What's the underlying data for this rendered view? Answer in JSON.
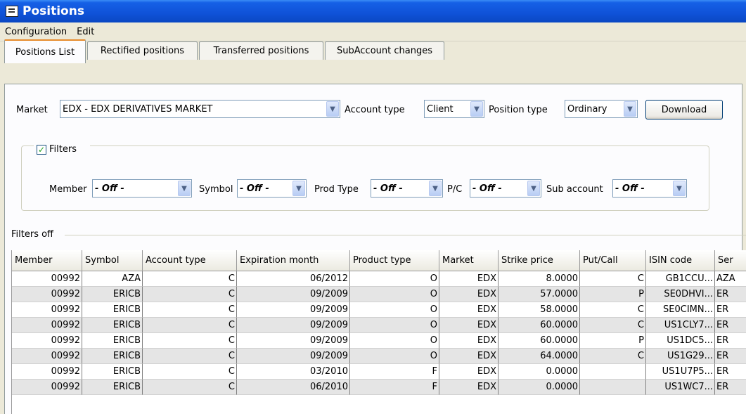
{
  "window": {
    "title": "Positions"
  },
  "menu": [
    "Configuration",
    "Edit"
  ],
  "tabs": [
    "Positions List",
    "Rectified positions",
    "Transferred positions",
    "SubAccount changes"
  ],
  "controls": {
    "market_label": "Market",
    "market_value": "EDX -  EDX DERIVATIVES MARKET",
    "account_type_label": "Account type",
    "account_type_value": "Client",
    "position_type_label": "Position type",
    "position_type_value": "Ordinary",
    "download_label": "Download"
  },
  "filters": {
    "label": "Filters",
    "checked": true,
    "member_label": "Member",
    "symbol_label": "Symbol",
    "prod_type_label": "Prod Type",
    "pc_label": "P/C",
    "sub_account_label": "Sub account",
    "off_value": "- Off -",
    "status": "Filters off"
  },
  "table": {
    "columns": [
      "Member",
      "Symbol",
      "Account type",
      "Expiration month",
      "Product type",
      "Market",
      "Strike price",
      "Put/Call",
      "ISIN code",
      "Ser"
    ],
    "rows": [
      [
        "00992",
        "AZA",
        "C",
        "06/2012",
        "O",
        "EDX",
        "8.0000",
        "C",
        "GB1CCU...",
        "AZA"
      ],
      [
        "00992",
        "ERICB",
        "C",
        "09/2009",
        "O",
        "EDX",
        "57.0000",
        "P",
        "SE0DHVI...",
        "ER"
      ],
      [
        "00992",
        "ERICB",
        "C",
        "09/2009",
        "O",
        "EDX",
        "58.0000",
        "C",
        "SE0CIMN...",
        "ER"
      ],
      [
        "00992",
        "ERICB",
        "C",
        "09/2009",
        "O",
        "EDX",
        "60.0000",
        "C",
        "US1CLY7...",
        "ER"
      ],
      [
        "00992",
        "ERICB",
        "C",
        "09/2009",
        "O",
        "EDX",
        "60.0000",
        "P",
        "US1DC5...",
        "ER"
      ],
      [
        "00992",
        "ERICB",
        "C",
        "09/2009",
        "O",
        "EDX",
        "64.0000",
        "C",
        "US1G29...",
        "ER"
      ],
      [
        "00992",
        "ERICB",
        "C",
        "03/2010",
        "F",
        "EDX",
        "0.0000",
        "",
        "US1U7P5...",
        "ER"
      ],
      [
        "00992",
        "ERICB",
        "C",
        "06/2010",
        "F",
        "EDX",
        "0.0000",
        "",
        "US1WC7...",
        "ER"
      ]
    ]
  }
}
